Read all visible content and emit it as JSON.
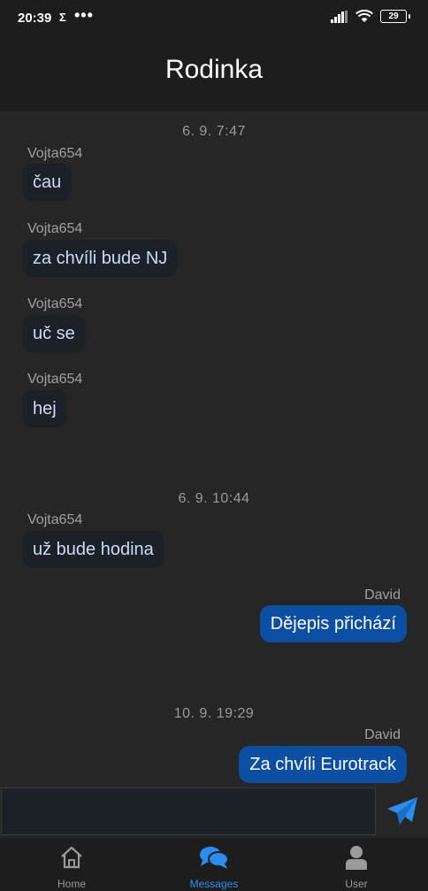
{
  "status": {
    "time": "20:39",
    "sigma": "Σ",
    "dots": "•••",
    "battery": "29"
  },
  "header": {
    "title": "Rodinka"
  },
  "chat": {
    "date1": "6. 9.  7:47",
    "m1_sender": "Vojta654",
    "m1_text": "čau",
    "m2_sender": "Vojta654",
    "m2_text": "za chvíli bude NJ",
    "m3_sender": "Vojta654",
    "m3_text": "uč se",
    "m4_sender": "Vojta654",
    "m4_text": "hej",
    "date2": "6. 9.  10:44",
    "m5_sender": "Vojta654",
    "m5_text": "už bude hodina",
    "m6_sender": "David",
    "m6_text": "Dějepis přichází",
    "date3": "10. 9.  19:29",
    "m7_sender": "David",
    "m7_text": "Za chvíli Eurotrack"
  },
  "input": {
    "value": "",
    "placeholder": ""
  },
  "colors": {
    "outgoing": "#0b4ea2",
    "incoming": "#1c2128",
    "accent": "#2d8cf0"
  },
  "nav": {
    "home_label": "Home",
    "home_icon": "home-icon",
    "messages_label": "Messages",
    "messages_icon": "chat-bubbles-icon",
    "user_label": "User",
    "user_icon": "user-icon",
    "active": "Messages"
  }
}
